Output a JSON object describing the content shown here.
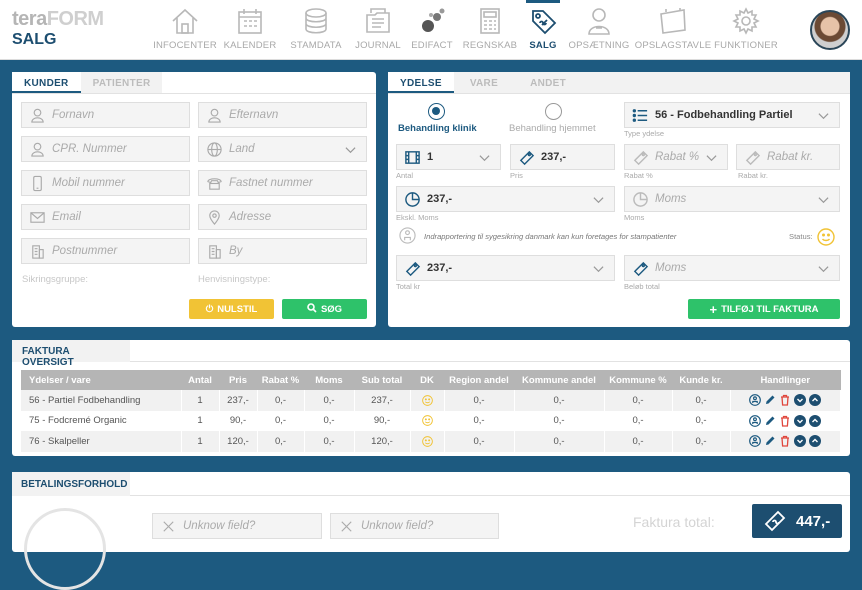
{
  "brand": {
    "name_light": "tera",
    "name_bold": "FORM",
    "section": "SALG"
  },
  "nav": [
    {
      "label": "INFOCENTER",
      "icon": "house-icon"
    },
    {
      "label": "KALENDER",
      "icon": "calendar-icon"
    },
    {
      "label": "STAMDATA",
      "icon": "database-icon"
    },
    {
      "label": "JOURNAL",
      "icon": "journal-icon"
    },
    {
      "label": "EDIFACT",
      "icon": "edifact-dots-icon"
    },
    {
      "label": "REGNSKAB",
      "icon": "calculator-icon"
    },
    {
      "label": "SALG",
      "icon": "price-tag-icon",
      "active": true
    },
    {
      "label": "OPSÆTNING",
      "icon": "person-setup-icon"
    },
    {
      "label": "OPSLAGSTAVLE",
      "icon": "noticeboard-icon"
    },
    {
      "label": "FUNKTIONER",
      "icon": "gear-icon"
    }
  ],
  "customer_panel": {
    "tabs": [
      "KUNDER",
      "PATIENTER"
    ],
    "fields": {
      "firstname": "Fornavn",
      "lastname": "Efternavn",
      "cpr": "CPR. Nummer",
      "country": "Land",
      "mobile": "Mobil nummer",
      "landline": "Fastnet nummer",
      "email": "Email",
      "address": "Adresse",
      "zip": "Postnummer",
      "city": "By"
    },
    "insurance_group": "Sikringsgruppe:",
    "referral_type": "Henvisningstype:",
    "reset_button": "NULSTIL",
    "search_button": "SØG"
  },
  "service_panel": {
    "tabs": [
      "YDELSE",
      "VARE",
      "ANDET"
    ],
    "radio_clinic": "Behandling klinik",
    "radio_home": "Behandling hjemmet",
    "service_type_value": "56 - Fodbehandling Partiel",
    "service_type_label": "Type ydelse",
    "quantity_value": "1",
    "quantity_label": "Antal",
    "price_value": "237,-",
    "price_label": "Pris",
    "discount_pct_placeholder": "Rabat %",
    "discount_pct_label": "Rabat %",
    "discount_kr_placeholder": "Rabat kr.",
    "discount_kr_label": "Rabat kr.",
    "excl_vat_value": "237,-",
    "excl_vat_label": "Ekskl. Moms",
    "vat_placeholder": "Moms",
    "vat_label": "Moms",
    "info_text": "Indrapportering til sygesikring danmark kan kun foretages for stampatienter",
    "status_label": "Status:",
    "total_value": "237,-",
    "total_label": "Total kr",
    "amount_placeholder": "Moms",
    "amount_label": "Beløb total",
    "add_button": "TILFØJ TIL FAKTURA"
  },
  "invoice": {
    "title": "FAKTURA OVERSIGT",
    "columns": [
      "Ydelser / vare",
      "Antal",
      "Pris",
      "Rabat %",
      "Moms",
      "Sub total",
      "DK",
      "Region andel",
      "Kommune andel",
      "Kommune %",
      "Kunde kr.",
      "Handlinger"
    ],
    "rows": [
      {
        "name": "56 - Partiel Fodbehandling",
        "qty": "1",
        "price": "237,-",
        "disc": "0,-",
        "vat": "0,-",
        "sub": "237,-",
        "region": "0,-",
        "muni": "0,-",
        "muni_pct": "0,-",
        "cust": "0,-"
      },
      {
        "name": "75 - Fodcremé Organic",
        "qty": "1",
        "price": "90,-",
        "disc": "0,-",
        "vat": "0,-",
        "sub": "90,-",
        "region": "0,-",
        "muni": "0,-",
        "muni_pct": "0,-",
        "cust": "0,-"
      },
      {
        "name": "76 - Skalpeller",
        "qty": "1",
        "price": "120,-",
        "disc": "0,-",
        "vat": "0,-",
        "sub": "120,-",
        "region": "0,-",
        "muni": "0,-",
        "muni_pct": "0,-",
        "cust": "0,-"
      }
    ]
  },
  "payment": {
    "title": "BETALINGSFORHOLD",
    "field1": "Unknow field?",
    "field2": "Unknow field?",
    "total_label": "Faktura total:",
    "total_value": "447,-"
  },
  "colors": {
    "primary": "#1d5a80",
    "green": "#2ec26a",
    "yellow": "#f1c335",
    "delete": "#e0463c"
  }
}
